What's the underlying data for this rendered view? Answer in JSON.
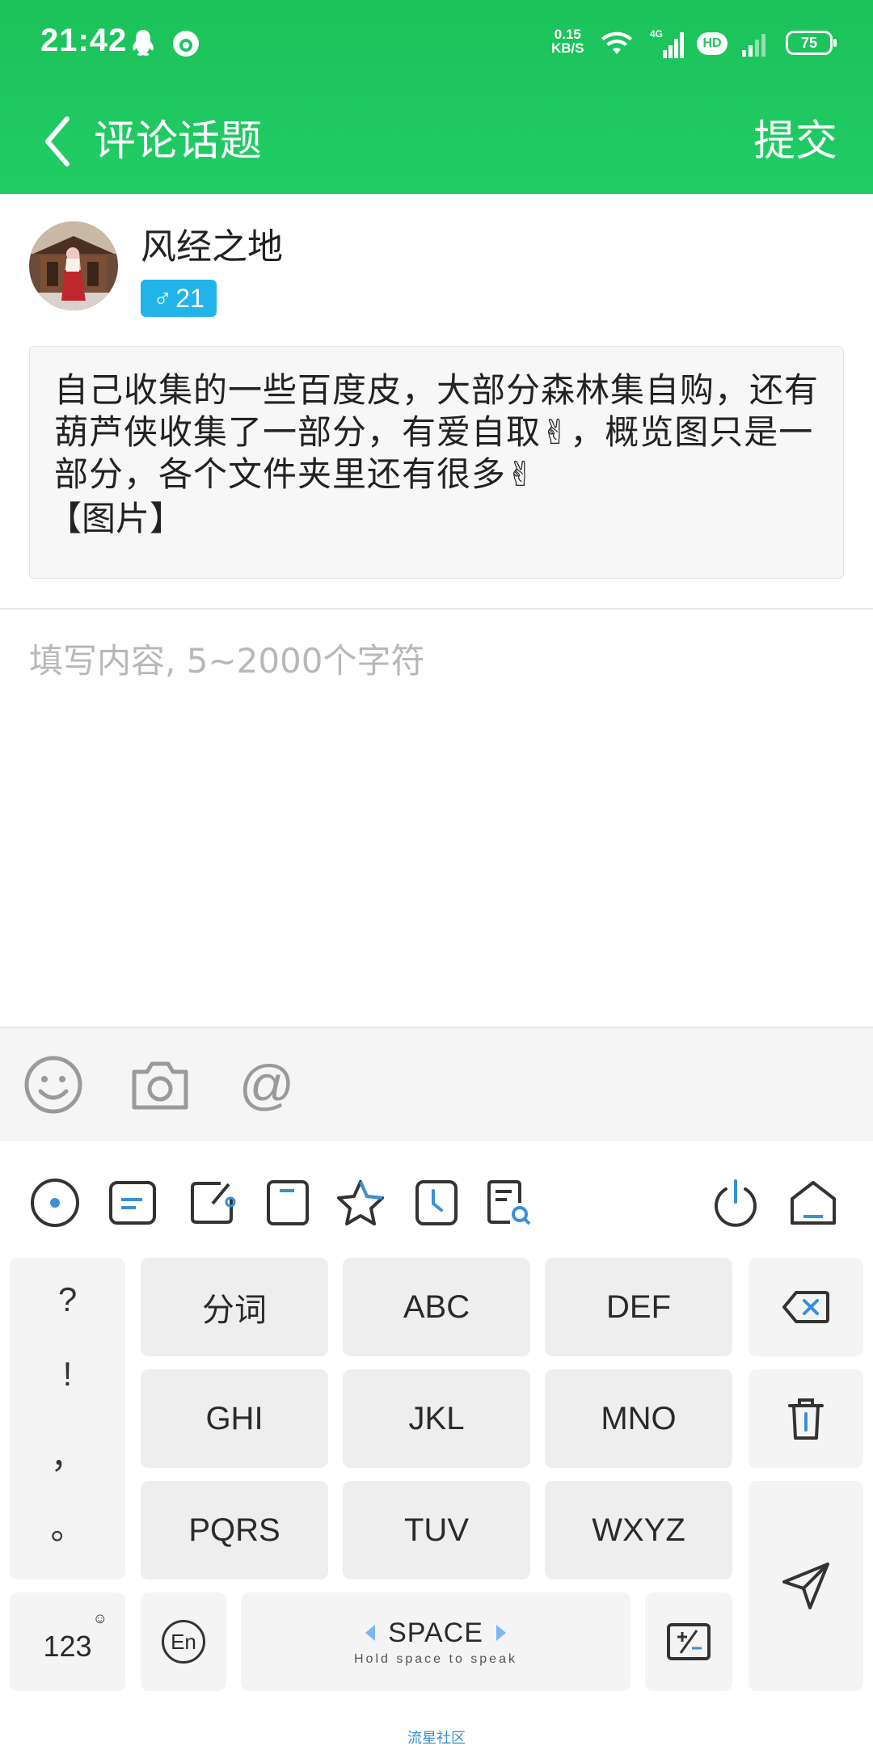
{
  "status_bar": {
    "time": "21:42",
    "net_speed_value": "0.15",
    "net_speed_unit": "KB/S",
    "network_type": "4G",
    "hd_label": "HD",
    "battery": "75"
  },
  "header": {
    "title": "评论话题",
    "submit_label": "提交"
  },
  "user": {
    "name": "风经之地",
    "gender_symbol": "♂",
    "level": "21"
  },
  "topic": {
    "text": "自己收集的一些百度皮，大部分森林集自购，还有葫芦侠收集了一部分，有爱自取✌，概览图只是一部分，各个文件夹里还有很多✌",
    "image_placeholder": "【图片】"
  },
  "comment": {
    "placeholder": "填写内容, 5~2000个字符",
    "value": ""
  },
  "attach_bar": {
    "items": [
      "emoji-icon",
      "camera-icon",
      "at-icon"
    ],
    "at_symbol": "@"
  },
  "keyboard": {
    "toolbar_icons": [
      "ime-logo-icon",
      "clipboard-icon",
      "handwriting-icon",
      "one-hand-icon",
      "favorite-icon",
      "history-icon",
      "search-note-icon",
      "power-icon",
      "hide-keyboard-icon"
    ],
    "punctuation": [
      "?",
      "!",
      "，",
      "。"
    ],
    "keys": {
      "k1": "分词",
      "k2": "ABC",
      "k3": "DEF",
      "k4": "GHI",
      "k5": "JKL",
      "k6": "MNO",
      "k7": "PQRS",
      "k8": "TUV",
      "k9": "WXYZ"
    },
    "num_key": "123",
    "lang_key": "En",
    "space_label": "SPACE",
    "space_hint": "Hold space to speak",
    "accent_color": "#7db7ef",
    "brand": "流星社区"
  },
  "colors": {
    "primary": "#1fc563",
    "badge": "#22b4e8",
    "placeholder": "#b8b8b8"
  }
}
